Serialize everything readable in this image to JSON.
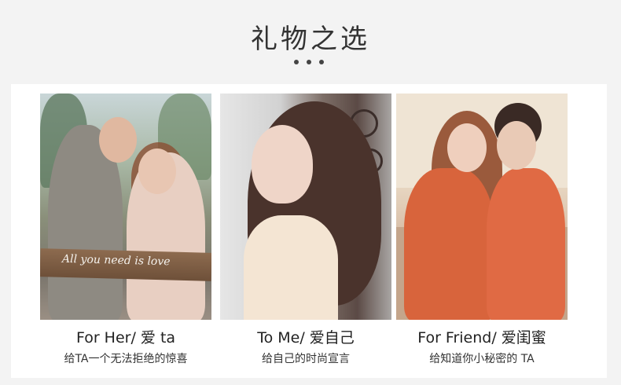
{
  "page": {
    "title": "礼物之选"
  },
  "cards": [
    {
      "title": "For Her/ 爱 ta",
      "subtitle": "给TA一个无法拒绝的惊喜",
      "sign_text": "All you need is love"
    },
    {
      "title": "To Me/ 爱自己",
      "subtitle": "给自己的时尚宣言"
    },
    {
      "title": "For Friend/ 爱闺蜜",
      "subtitle": "给知道你小秘密的 TA"
    }
  ],
  "colors": {
    "background": "#f3f3f3",
    "card_area": "#ffffff",
    "title_text": "#333333",
    "dot": "#444444"
  }
}
